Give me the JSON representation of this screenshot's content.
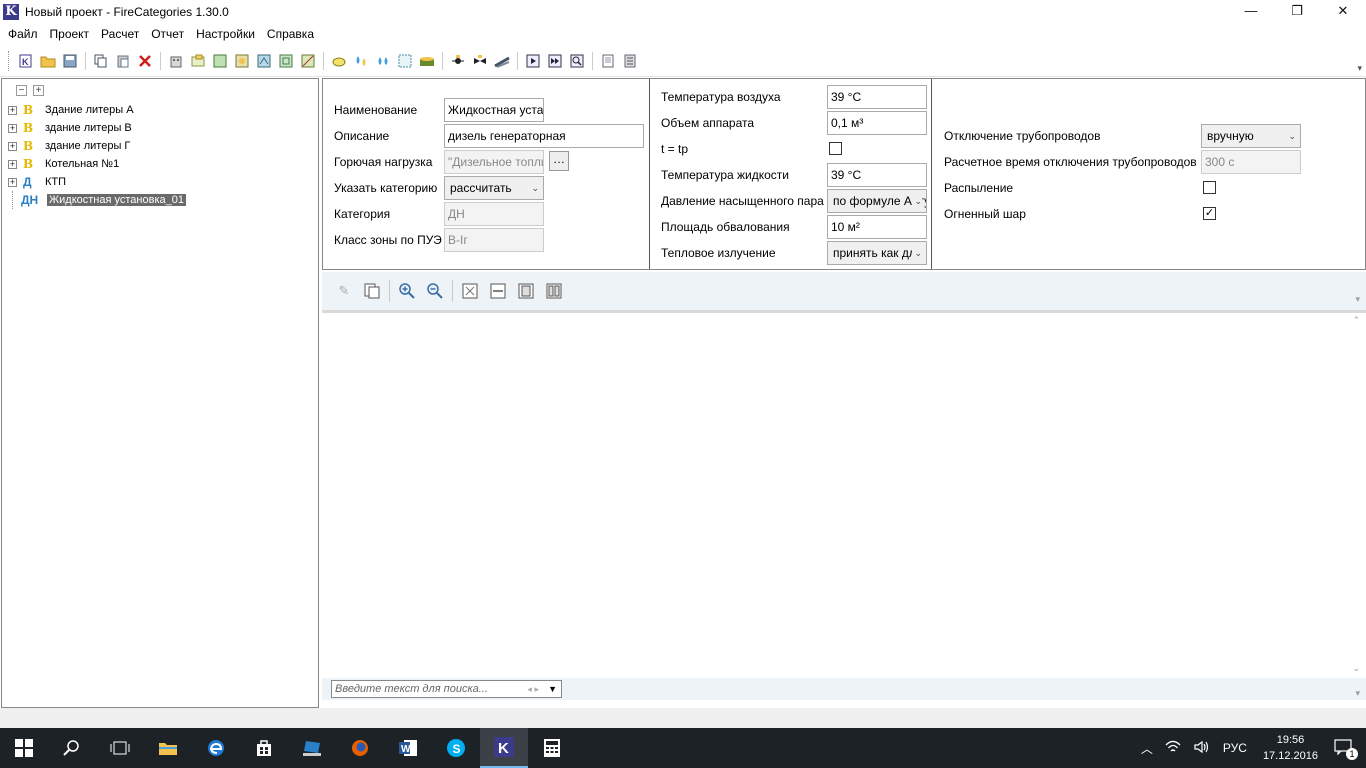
{
  "window": {
    "title": "Новый проект - FireCategories 1.30.0",
    "logo": "K",
    "controls": [
      "—",
      "❐",
      "✕"
    ]
  },
  "menu": [
    "Файл",
    "Проект",
    "Расчет",
    "Отчет",
    "Настройки",
    "Справка"
  ],
  "toolbar_icons": [
    "new-project-icon",
    "open-folder-icon",
    "save-icon",
    "copy-icon",
    "paste-icon",
    "delete-icon",
    "building-icon",
    "room-icon",
    "grid1-icon",
    "grid2-icon",
    "grid3-icon",
    "grid4-icon",
    "grid5-icon",
    "substance-icon",
    "drops-icon",
    "drops2-icon",
    "pattern-icon",
    "tank-icon",
    "pump-icon",
    "valve-icon",
    "pipe-icon",
    "play-icon",
    "fast-forward-icon",
    "magnifier-icon",
    "report-icon",
    "list-icon"
  ],
  "tree": {
    "items": [
      {
        "cat": "В",
        "label": "Здание литеры А",
        "expandable": true,
        "cat_type": "B"
      },
      {
        "cat": "В",
        "label": "здание литеры В",
        "expandable": true,
        "cat_type": "B"
      },
      {
        "cat": "В",
        "label": "здание литеры Г",
        "expandable": true,
        "cat_type": "B"
      },
      {
        "cat": "В",
        "label": "Котельная №1",
        "expandable": true,
        "cat_type": "B"
      },
      {
        "cat": "Д",
        "label": "КТП",
        "expandable": true,
        "cat_type": "D"
      },
      {
        "cat": "ДН",
        "label": "Жидкостная установка_01",
        "expandable": false,
        "cat_type": "D",
        "selected": true
      }
    ]
  },
  "props": {
    "col1": {
      "name_label": "Наименование",
      "name_value": "Жидкостная устаı",
      "desc_label": "Описание",
      "desc_value": "дизель генераторная",
      "load_label": "Горючая нагрузка",
      "load_value": "\"Дизельное топли",
      "load_btn": "…",
      "cat_mode_label": "Указать категорию",
      "cat_mode_value": "рассчитать",
      "category_label": "Категория",
      "category_value": "ДН",
      "zone_label": "Класс зоны по ПУЭ",
      "zone_value": "В-Iг"
    },
    "col2": {
      "air_temp_label": "Температура воздуха",
      "air_temp_value": "39 °С",
      "volume_label": "Объем аппарата",
      "volume_value": "0,1 м³",
      "ttp_label": "t = tp",
      "liquid_temp_label": "Температура жидкости",
      "liquid_temp_value": "39 °С",
      "pressure_label": "Давление насыщенного пара",
      "pressure_value": "по формуле Антуана",
      "area_label": "Площадь обвалования",
      "area_value": "10 м²",
      "radiation_label": "Тепловое излучение",
      "radiation_value": "принять как для факела"
    },
    "col3": {
      "shutoff_label": "Отключение трубопроводов",
      "shutoff_value": "вручную",
      "shutoff_time_label": "Расчетное время отключения трубопроводов",
      "shutoff_time_value": "300 с",
      "spray_label": "Распыление",
      "spray_checked": false,
      "fireball_label": "Огненный шар",
      "fireball_checked": true
    }
  },
  "viewer": {
    "search_placeholder": "Введите текст для поиска...",
    "search_prev": "◂",
    "search_next": "▸",
    "search_dropdown": "▼"
  },
  "taskbar": {
    "lang": "РУС",
    "time": "19:56",
    "date": "17.12.2016",
    "notifications": "1"
  }
}
